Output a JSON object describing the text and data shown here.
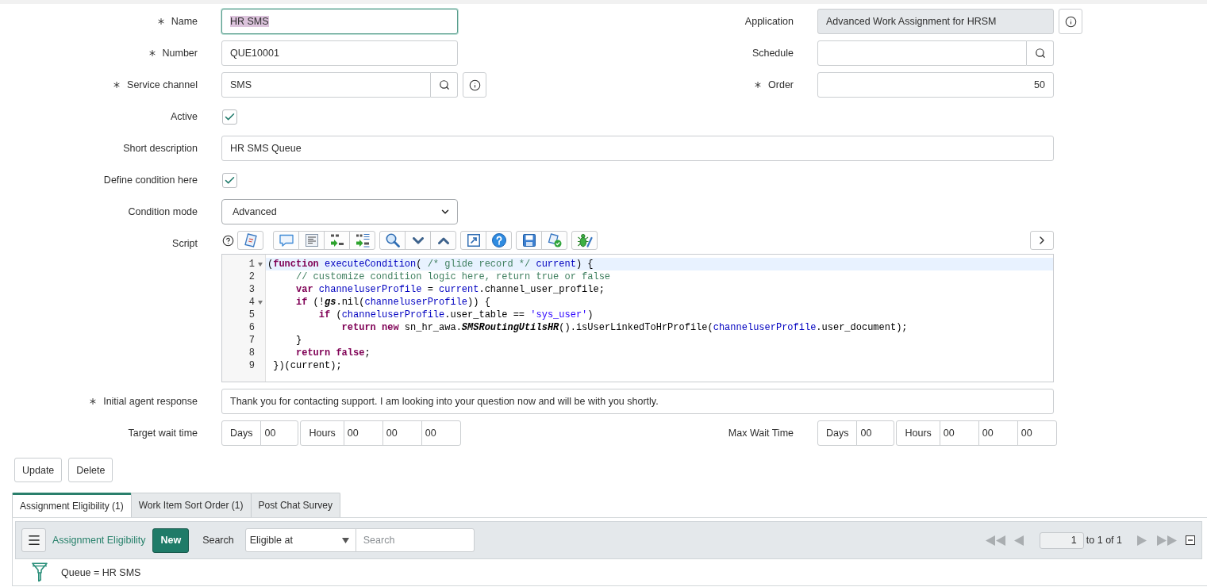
{
  "form": {
    "rows": [
      {
        "left": {
          "kind": "text",
          "label": "Name",
          "mandatory": true,
          "focused": true,
          "info_button": false,
          "value": "HR SMS"
        },
        "right": {
          "kind": "readonly",
          "label": "Application",
          "mandatory": false,
          "focused": false,
          "info_button": true,
          "value": "Advanced Work Assignment for HRSM"
        }
      },
      {
        "left": {
          "kind": "text",
          "label": "Number",
          "mandatory": true,
          "focused": false,
          "info_button": false,
          "value": "QUE10001"
        },
        "right": {
          "kind": "reference",
          "label": "Schedule",
          "mandatory": false,
          "focused": false,
          "info_button": false
        }
      },
      {
        "left": {
          "kind": "reference",
          "label": "Service channel",
          "mandatory": true,
          "focused": false,
          "info_button": true,
          "value": "SMS"
        },
        "right": {
          "kind": "number",
          "label": "Order",
          "mandatory": true,
          "focused": false,
          "info_button": false,
          "value": "50"
        }
      },
      {
        "left": {
          "kind": "checkbox",
          "label": "Active",
          "mandatory": false,
          "focused": false,
          "info_button": false,
          "checked": true
        }
      },
      {
        "left": {
          "kind": "wide_text",
          "label": "Short description",
          "mandatory": false,
          "focused": false,
          "info_button": false,
          "value": "HR SMS Queue"
        }
      },
      {
        "left": {
          "kind": "checkbox",
          "label": "Define condition here",
          "mandatory": false,
          "focused": false,
          "info_button": false,
          "checked": true
        }
      },
      {
        "left": {
          "kind": "select",
          "label": "Condition mode",
          "mandatory": false,
          "focused": false,
          "info_button": false,
          "value": "Advanced"
        }
      },
      {
        "left": {
          "kind": "script",
          "label": "Script",
          "mandatory": false,
          "focused": false,
          "info_button": false,
          "lines": [
            {
              "number": "1",
              "foldable": true,
              "highlighted": true,
              "tokens": [
                {
                  "kind": "plain",
                  "text": "("
                },
                {
                  "kind": "keyword",
                  "text": "function"
                },
                {
                  "kind": "def",
                  "text": " executeCondition"
                },
                {
                  "kind": "plain",
                  "text": "( "
                },
                {
                  "kind": "comment",
                  "text": "/* glide record */"
                },
                {
                  "kind": "variable",
                  "text": " current"
                },
                {
                  "kind": "plain",
                  "text": ") {"
                }
              ]
            },
            {
              "number": "2",
              "foldable": false,
              "highlighted": false,
              "tokens": [
                {
                  "kind": "comment",
                  "text": "     // customize condition logic here, return true or false"
                }
              ]
            },
            {
              "number": "3",
              "foldable": false,
              "highlighted": false,
              "tokens": [
                {
                  "kind": "keyword",
                  "text": "     var"
                },
                {
                  "kind": "variable",
                  "text": " channeluserProfile"
                },
                {
                  "kind": "plain",
                  "text": " = "
                },
                {
                  "kind": "variable",
                  "text": "current"
                },
                {
                  "kind": "plain",
                  "text": ".channel_user_profile;"
                }
              ]
            },
            {
              "number": "4",
              "foldable": true,
              "highlighted": false,
              "tokens": [
                {
                  "kind": "keyword",
                  "text": "     if"
                },
                {
                  "kind": "plain",
                  "text": " (!"
                },
                {
                  "kind": "class",
                  "text": "gs"
                },
                {
                  "kind": "plain",
                  "text": ".nil("
                },
                {
                  "kind": "variable",
                  "text": "channeluserProfile"
                },
                {
                  "kind": "plain",
                  "text": ")) {"
                }
              ]
            },
            {
              "number": "5",
              "foldable": false,
              "highlighted": false,
              "tokens": [
                {
                  "kind": "keyword",
                  "text": "         if"
                },
                {
                  "kind": "plain",
                  "text": " ("
                },
                {
                  "kind": "variable",
                  "text": "channeluserProfile"
                },
                {
                  "kind": "plain",
                  "text": ".user_table == "
                },
                {
                  "kind": "string",
                  "text": "'sys_user'"
                },
                {
                  "kind": "plain",
                  "text": ")"
                }
              ]
            },
            {
              "number": "6",
              "foldable": false,
              "highlighted": false,
              "tokens": [
                {
                  "kind": "keyword",
                  "text": "             return new"
                },
                {
                  "kind": "plain",
                  "text": " sn_hr_awa."
                },
                {
                  "kind": "class",
                  "text": "SMSRoutingUtilsHR"
                },
                {
                  "kind": "plain",
                  "text": "().isUserLinkedToHrProfile("
                },
                {
                  "kind": "variable",
                  "text": "channeluserProfile"
                },
                {
                  "kind": "plain",
                  "text": ".user_document);"
                }
              ]
            },
            {
              "number": "7",
              "foldable": false,
              "highlighted": false,
              "tokens": [
                {
                  "kind": "plain",
                  "text": "     }"
                }
              ]
            },
            {
              "number": "8",
              "foldable": false,
              "highlighted": false,
              "tokens": [
                {
                  "kind": "keyword",
                  "text": "     return false"
                },
                {
                  "kind": "plain",
                  "text": ";"
                }
              ]
            },
            {
              "number": "9",
              "foldable": false,
              "highlighted": false,
              "tokens": [
                {
                  "kind": "plain",
                  "text": " })(current);"
                }
              ]
            }
          ]
        }
      },
      {
        "left": {
          "kind": "wide_text",
          "label": "Initial agent response",
          "mandatory": true,
          "focused": false,
          "info_button": false,
          "value": "Thank you for contacting support. I am looking into your question now and will be with you shortly."
        }
      },
      {
        "left": {
          "kind": "duration",
          "label": "Target wait time",
          "mandatory": false,
          "focused": false,
          "info_button": false,
          "units": [
            {
              "label": "Days",
              "values": [
                "00"
              ]
            },
            {
              "label": "Hours",
              "values": [
                "00",
                "00",
                "00"
              ]
            }
          ]
        },
        "right": {
          "kind": "duration",
          "label": "Max Wait Time",
          "mandatory": false,
          "focused": false,
          "info_button": false,
          "units": [
            {
              "label": "Days",
              "values": [
                "00"
              ]
            },
            {
              "label": "Hours",
              "values": [
                "00",
                "00",
                "00"
              ]
            }
          ]
        }
      }
    ]
  },
  "buttons": [
    {
      "label": "Update"
    },
    {
      "label": "Delete"
    }
  ],
  "related": {
    "tabs": [
      {
        "label": "Assignment Eligibility (1)",
        "selected": true
      },
      {
        "label": "Work Item Sort Order (1)",
        "selected": false
      },
      {
        "label": "Post Chat Survey",
        "selected": false
      }
    ],
    "list": {
      "title": "Assignment Eligibility",
      "new_button": "New",
      "search_label": "Search",
      "search_field": "Eligible at",
      "search_placeholder": "Search",
      "pager": {
        "page": "1",
        "range": "to 1 of 1",
        "controls": [
          {
            "kind": "first",
            "disabled": true
          },
          {
            "kind": "previous",
            "disabled": true
          },
          {
            "kind": "next",
            "disabled": true
          },
          {
            "kind": "last",
            "disabled": true
          }
        ]
      },
      "filter": "Queue = HR SMS"
    }
  }
}
